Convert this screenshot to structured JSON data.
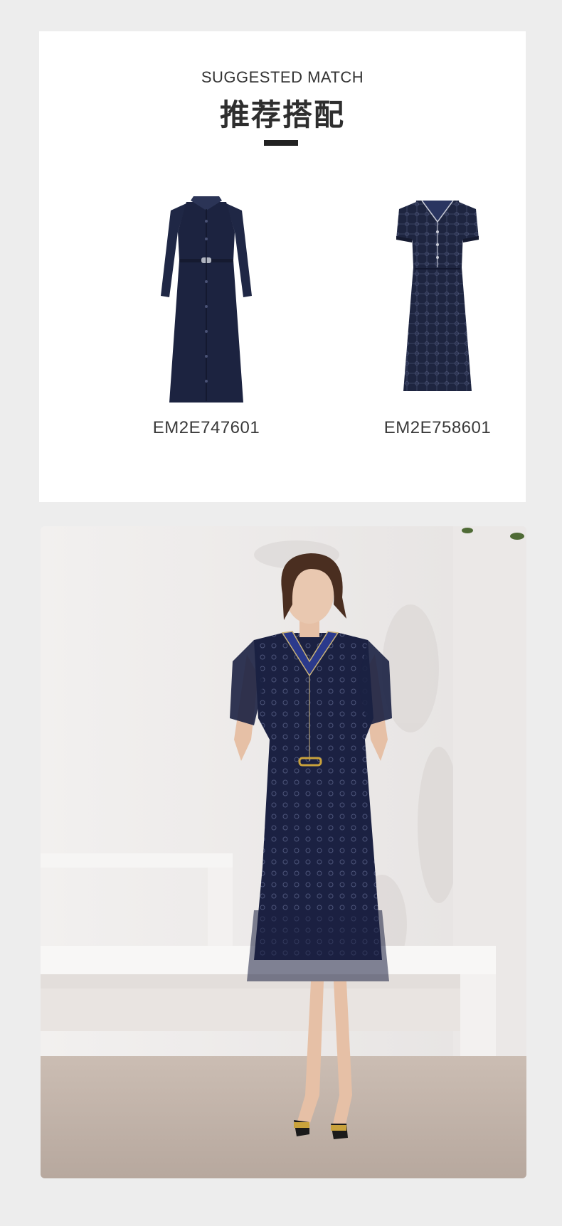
{
  "match_section": {
    "subtitle": "SUGGESTED MATCH",
    "title": "推荐搭配",
    "products": [
      {
        "code": "EM2E747601"
      },
      {
        "code": "EM2E758601"
      }
    ]
  },
  "colors": {
    "page_bg": "#ededed",
    "card_bg": "#ffffff",
    "dress_navy": "#1c2340",
    "text_dark": "#333333"
  }
}
